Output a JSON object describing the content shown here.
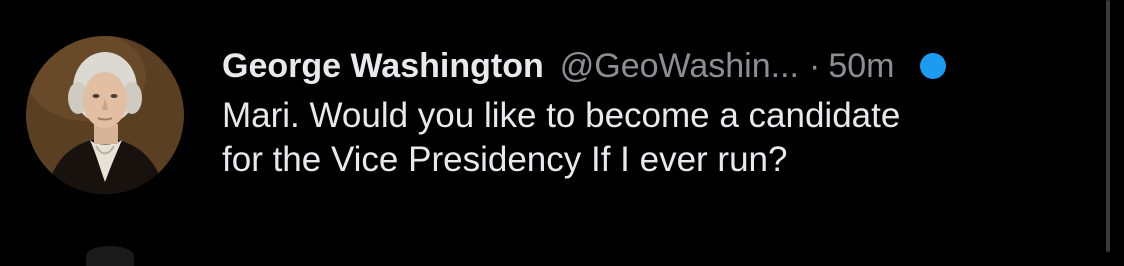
{
  "tweet": {
    "author_name": "George Washington",
    "handle": "@GeoWashin...",
    "separator": "·",
    "time": "50m",
    "text": "Mari. Would you like to become a candidate\nfor the Vice Presidency If I ever run?"
  },
  "colors": {
    "background": "#000000",
    "primary_text": "#e7e9ea",
    "secondary_text": "#8b8f94",
    "accent": "#1d9bf0"
  },
  "icons": {
    "avatar": "portrait-avatar",
    "unread": "unread-dot-icon"
  }
}
